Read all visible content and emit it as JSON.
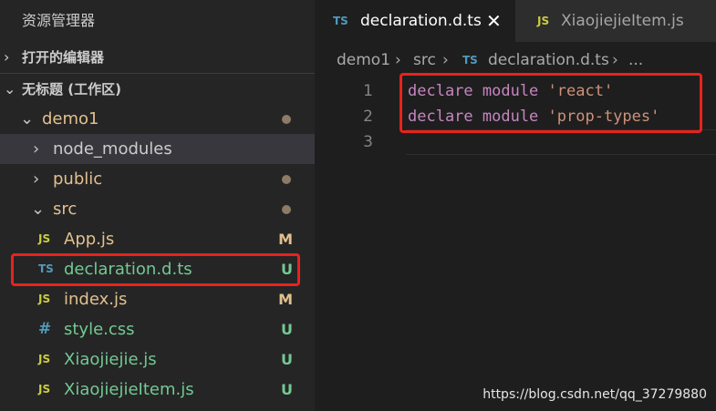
{
  "explorer": {
    "title": "资源管理器",
    "open_editors": "打开的编辑器",
    "workspace": "无标题 (工作区)",
    "tree": [
      {
        "name": "demo1",
        "type": "folder",
        "indicator": "dot"
      },
      {
        "name": "node_modules",
        "type": "folder",
        "indicator": ""
      },
      {
        "name": "public",
        "type": "folder",
        "indicator": "dot"
      },
      {
        "name": "src",
        "type": "folder",
        "indicator": "dot"
      },
      {
        "name": "App.js",
        "icon": "JS",
        "status": "M"
      },
      {
        "name": "declaration.d.ts",
        "icon": "TS",
        "status": "U"
      },
      {
        "name": "index.js",
        "icon": "JS",
        "status": "M"
      },
      {
        "name": "style.css",
        "icon": "#",
        "status": "U"
      },
      {
        "name": "Xiaojiejie.js",
        "icon": "JS",
        "status": "U"
      },
      {
        "name": "XiaojiejieItem.js",
        "icon": "JS",
        "status": "U"
      }
    ],
    "chevrons": {
      "collapsed": "›",
      "expanded": "⌄"
    }
  },
  "tabs": [
    {
      "label": "declaration.d.ts",
      "icon": "TS",
      "close": "✕"
    },
    {
      "label": "XiaojiejieItem.js",
      "icon": "JS"
    }
  ],
  "breadcrumb": {
    "items": [
      "demo1",
      "src",
      "declaration.d.ts",
      "..."
    ],
    "sep": "›",
    "ts_icon": "TS"
  },
  "code": [
    {
      "num": "1",
      "kw": "declare module ",
      "str": "'react'"
    },
    {
      "num": "2",
      "kw": "declare module ",
      "str": "'prop-types'"
    },
    {
      "num": "3",
      "kw": "",
      "str": ""
    }
  ],
  "watermark": "https://blog.csdn.net/qq_37279880",
  "colors": {
    "accent_red": "#e8231c",
    "modified": "#e2c08d",
    "untracked": "#73c991",
    "js_icon": "#cbcb41",
    "ts_icon": "#519aba"
  }
}
